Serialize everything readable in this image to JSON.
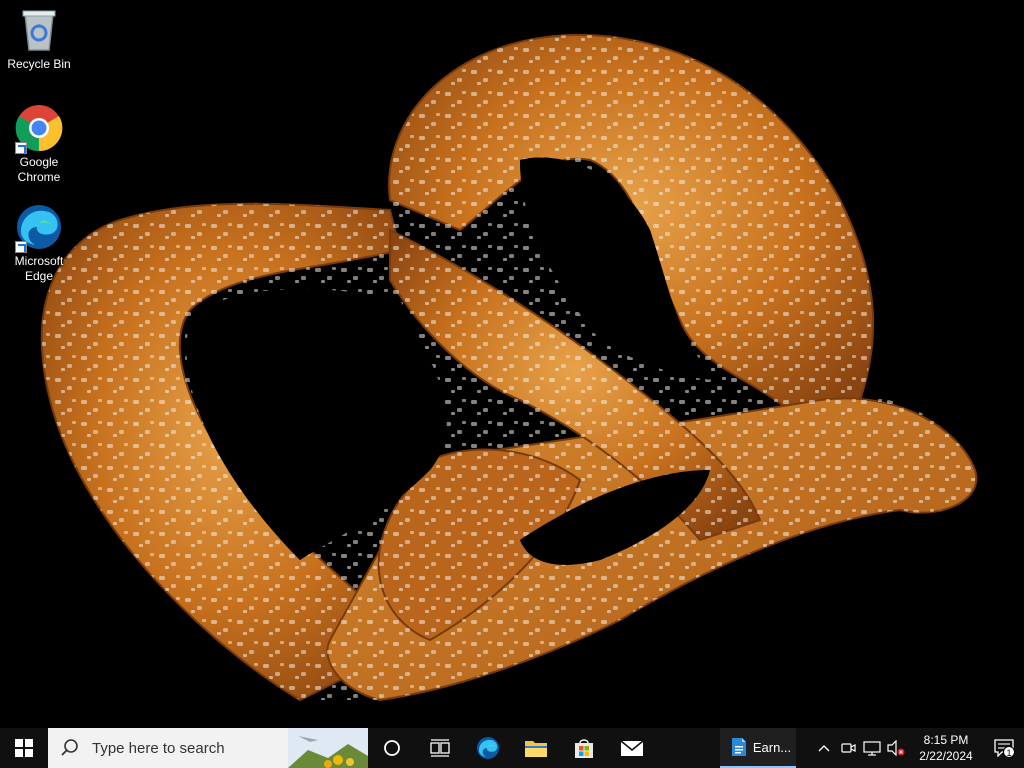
{
  "desktop": {
    "icons": [
      {
        "name": "recycle-bin",
        "label": "Recycle Bin"
      },
      {
        "name": "google-chrome",
        "label": "Google\nChrome"
      },
      {
        "name": "microsoft-edge",
        "label": "Microsoft\nEdge"
      }
    ],
    "wallpaper": "soft-pretzel-icon"
  },
  "taskbar": {
    "search_placeholder": "Type here to search",
    "pinned_apps": [
      "edge-icon",
      "file-explorer-icon",
      "microsoft-store-icon",
      "mail-icon"
    ],
    "open_doc_label": "Earn...",
    "clock_time": "8:15 PM",
    "clock_date": "2/22/2024",
    "notification_count": "1"
  },
  "colors": {
    "taskbar": "#101010",
    "search_box": "#f2f2f2",
    "accent": "#0078d7",
    "active_underline": "#8cc8ff"
  }
}
